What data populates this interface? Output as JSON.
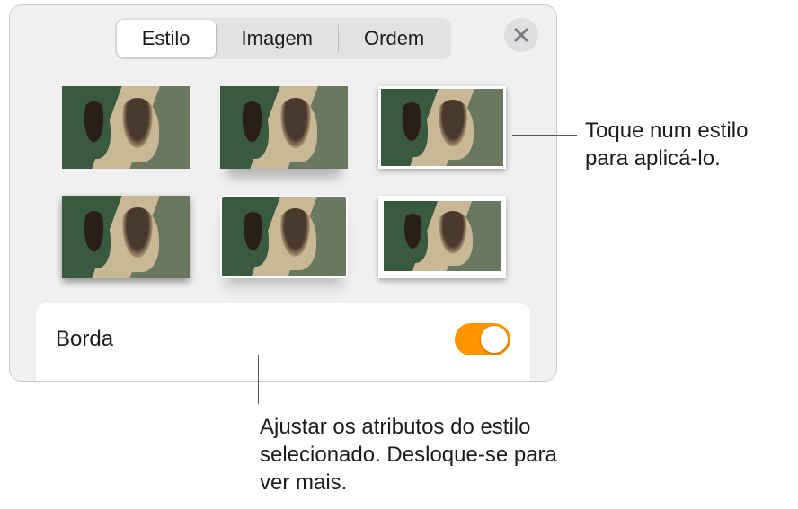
{
  "tabs": {
    "style": "Estilo",
    "image": "Imagem",
    "arrange": "Ordem",
    "active": "Estilo"
  },
  "options": {
    "border_label": "Borda",
    "border_on": true
  },
  "callouts": {
    "tap_style": "Toque num estilo para aplicá-lo.",
    "adjust_attrs": "Ajustar os atributos do estilo selecionado. Desloque-se para ver mais."
  }
}
